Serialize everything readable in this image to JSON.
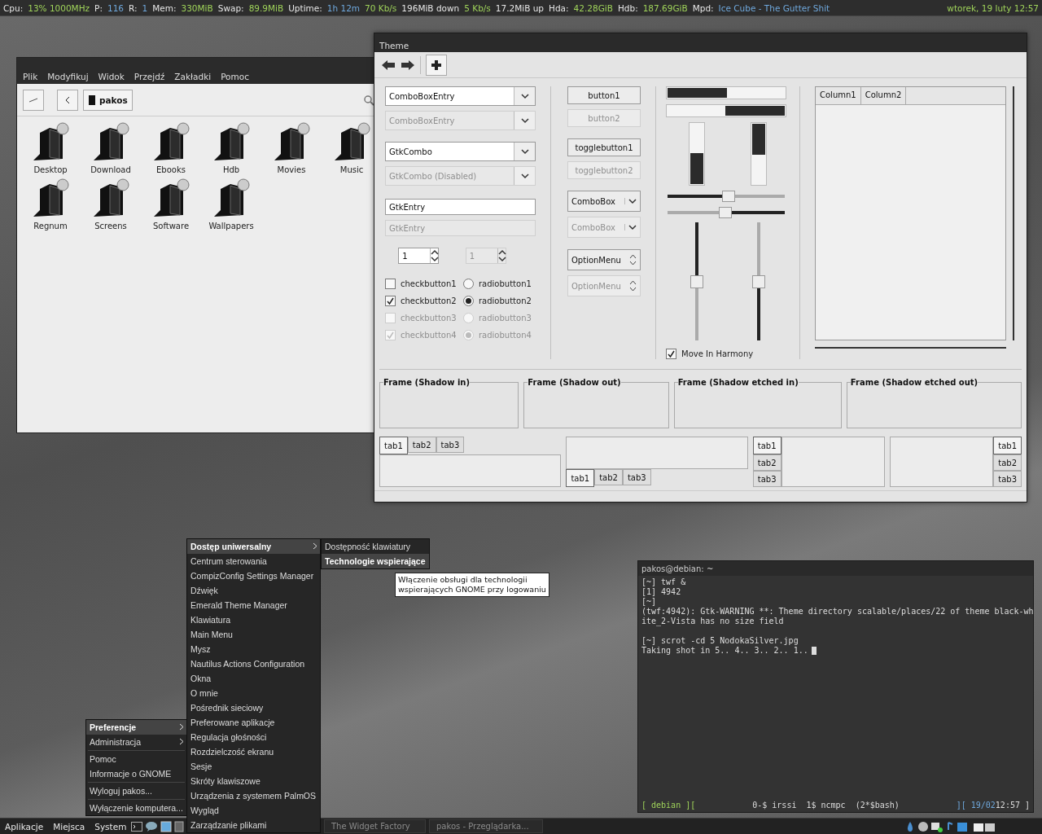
{
  "top_bar": {
    "items": [
      {
        "text": "Cpu:",
        "kind": "label"
      },
      {
        "text": "13% 1000MHz",
        "kind": "value"
      },
      {
        "text": "P:",
        "kind": "label"
      },
      {
        "text": "116",
        "kind": "accent"
      },
      {
        "text": "R:",
        "kind": "label"
      },
      {
        "text": "1",
        "kind": "accent"
      },
      {
        "text": "Mem:",
        "kind": "label"
      },
      {
        "text": "330MiB",
        "kind": "value"
      },
      {
        "text": "Swap:",
        "kind": "label"
      },
      {
        "text": "89.9MiB",
        "kind": "value"
      },
      {
        "text": "Uptime:",
        "kind": "label"
      },
      {
        "text": "1h 12m",
        "kind": "accent"
      },
      {
        "text": "70 Kb/s",
        "kind": "value"
      },
      {
        "text": "196MiB down",
        "kind": "label"
      },
      {
        "text": "5 Kb/s",
        "kind": "value"
      },
      {
        "text": "17.2MiB up",
        "kind": "label"
      },
      {
        "text": "Hda:",
        "kind": "label"
      },
      {
        "text": "42.28GiB",
        "kind": "value"
      },
      {
        "text": "Hdb:",
        "kind": "label"
      },
      {
        "text": "187.69GiB",
        "kind": "value"
      },
      {
        "text": "Mpd:",
        "kind": "label"
      },
      {
        "text": "Ice Cube - The Gutter Shit",
        "kind": "accent"
      }
    ],
    "clock": "wtorek, 19 luty 12:57"
  },
  "file_manager": {
    "menu": [
      "Plik",
      "Modyfikuj",
      "Widok",
      "Przejdź",
      "Zakładki",
      "Pomoc"
    ],
    "location": "pakos",
    "files": [
      {
        "name": "Desktop"
      },
      {
        "name": "Download"
      },
      {
        "name": "Ebooks"
      },
      {
        "name": "Hdb"
      },
      {
        "name": "Movies"
      },
      {
        "name": "Music"
      },
      {
        "name": "Regnum"
      },
      {
        "name": "Screens"
      },
      {
        "name": "Software"
      },
      {
        "name": "Wallpapers"
      }
    ]
  },
  "theme_window": {
    "title": "Theme",
    "combos": [
      {
        "text": "ComboBoxEntry",
        "disabled": false
      },
      {
        "text": "ComboBoxEntry",
        "disabled": true
      },
      {
        "text": "GtkCombo",
        "disabled": false
      },
      {
        "text": "GtkCombo (Disabled)",
        "disabled": true
      }
    ],
    "entries": [
      {
        "value": "GtkEntry",
        "disabled": false
      },
      {
        "value": "GtkEntry",
        "disabled": true
      }
    ],
    "spins": [
      {
        "value": "1",
        "disabled": false
      },
      {
        "value": "1",
        "disabled": true
      }
    ],
    "checks": [
      {
        "label": "checkbutton1",
        "checked": false,
        "disabled": false
      },
      {
        "label": "checkbutton2",
        "checked": true,
        "disabled": false
      },
      {
        "label": "checkbutton3",
        "checked": false,
        "disabled": true
      },
      {
        "label": "checkbutton4",
        "checked": true,
        "disabled": true
      }
    ],
    "radios": [
      {
        "label": "radiobutton1",
        "selected": false,
        "disabled": false
      },
      {
        "label": "radiobutton2",
        "selected": true,
        "disabled": false
      },
      {
        "label": "radiobutton3",
        "selected": false,
        "disabled": true
      },
      {
        "label": "radiobutton4",
        "selected": true,
        "disabled": true
      }
    ],
    "buttons": [
      {
        "label": "button1",
        "kind": "button",
        "disabled": false
      },
      {
        "label": "button2",
        "kind": "button",
        "disabled": true
      },
      {
        "label": "togglebutton1",
        "kind": "button",
        "disabled": false
      },
      {
        "label": "togglebutton2",
        "kind": "button",
        "disabled": true
      },
      {
        "label": "ComboBox",
        "kind": "combo",
        "disabled": false
      },
      {
        "label": "ComboBox",
        "kind": "combo",
        "disabled": true
      },
      {
        "label": "OptionMenu",
        "kind": "option",
        "disabled": false
      },
      {
        "label": "OptionMenu",
        "kind": "option",
        "disabled": true
      }
    ],
    "progress": {
      "horizontal": [
        {
          "inverted": false,
          "level": 0.5
        },
        {
          "inverted": true,
          "level": 0.5
        }
      ],
      "vertical": [
        {
          "inverted": false,
          "level": 0.5
        },
        {
          "inverted": true,
          "level": 0.5
        }
      ]
    },
    "scales": {
      "horizontal": [
        {
          "inverted": false,
          "level": 0.52
        },
        {
          "inverted": true,
          "level": 0.49
        }
      ],
      "vertical": [
        {
          "inverted": true,
          "level": 0.5
        },
        {
          "inverted": false,
          "level": 0.5
        }
      ]
    },
    "harmony": {
      "label": "Move In Harmony",
      "checked": true
    },
    "tree": {
      "columns": [
        "Column1",
        "Column2"
      ]
    },
    "frames": [
      "Frame (Shadow in)",
      "Frame (Shadow out)",
      "Frame (Shadow etched in)",
      "Frame (Shadow etched out)"
    ],
    "notebooks": {
      "top": {
        "tabs": [
          {
            "label": "tab1",
            "selected": true
          },
          {
            "label": "tab2",
            "selected": false
          },
          {
            "label": "tab3",
            "selected": false
          }
        ]
      },
      "bottom": {
        "tabs": [
          {
            "label": "tab1",
            "selected": true
          },
          {
            "label": "tab2",
            "selected": false
          },
          {
            "label": "tab3",
            "selected": false
          }
        ]
      },
      "left": {
        "tabs": [
          {
            "label": "tab1",
            "selected": true
          },
          {
            "label": "tab2",
            "selected": false
          },
          {
            "label": "tab3",
            "selected": false
          }
        ]
      },
      "right": {
        "tabs": [
          {
            "label": "tab1",
            "selected": true
          },
          {
            "label": "tab2",
            "selected": false
          },
          {
            "label": "tab3",
            "selected": false
          }
        ]
      }
    }
  },
  "system_menu": {
    "groups": [
      {
        "items": [
          {
            "label": "Preferencje",
            "selected": true,
            "submenu": true
          },
          {
            "label": "Administracja",
            "selected": false,
            "submenu": true
          }
        ]
      },
      {
        "items": [
          {
            "label": "Pomoc",
            "selected": false,
            "submenu": false
          },
          {
            "label": "Informacje o GNOME",
            "selected": false,
            "submenu": false
          }
        ]
      },
      {
        "items": [
          {
            "label": "Wyloguj pakos...",
            "selected": false,
            "submenu": false
          }
        ]
      },
      {
        "items": [
          {
            "label": "Wyłączenie komputera...",
            "selected": false,
            "submenu": false
          }
        ]
      }
    ]
  },
  "preferences_menu": {
    "items": [
      {
        "label": "Dostęp uniwersalny",
        "selected": true,
        "submenu": true
      },
      {
        "label": "Centrum sterowania",
        "selected": false,
        "submenu": false
      },
      {
        "label": "CompizConfig Settings Manager",
        "selected": false,
        "submenu": false
      },
      {
        "label": "Dźwięk",
        "selected": false,
        "submenu": false
      },
      {
        "label": "Emerald Theme Manager",
        "selected": false,
        "submenu": false
      },
      {
        "label": "Klawiatura",
        "selected": false,
        "submenu": false
      },
      {
        "label": "Main Menu",
        "selected": false,
        "submenu": false
      },
      {
        "label": "Mysz",
        "selected": false,
        "submenu": false
      },
      {
        "label": "Nautilus Actions Configuration",
        "selected": false,
        "submenu": false
      },
      {
        "label": "Okna",
        "selected": false,
        "submenu": false
      },
      {
        "label": "O mnie",
        "selected": false,
        "submenu": false
      },
      {
        "label": "Pośrednik sieciowy",
        "selected": false,
        "submenu": false
      },
      {
        "label": "Preferowane aplikacje",
        "selected": false,
        "submenu": false
      },
      {
        "label": "Regulacja głośności",
        "selected": false,
        "submenu": false
      },
      {
        "label": "Rozdzielczość ekranu",
        "selected": false,
        "submenu": false
      },
      {
        "label": "Sesje",
        "selected": false,
        "submenu": false
      },
      {
        "label": "Skróty klawiszowe",
        "selected": false,
        "submenu": false
      },
      {
        "label": "Urządzenia z systemem PalmOS",
        "selected": false,
        "submenu": false
      },
      {
        "label": "Wygląd",
        "selected": false,
        "submenu": false
      },
      {
        "label": "Zarządzanie plikami",
        "selected": false,
        "submenu": false
      }
    ]
  },
  "accessibility_menu": {
    "items": [
      {
        "label": "Dostępność klawiatury",
        "selected": false
      },
      {
        "label": "Technologie wspierające",
        "selected": true
      }
    ]
  },
  "tooltip": "Włączenie obsługi dla technologii wspierających GNOME przy logowaniu",
  "terminal": {
    "title": "pakos@debian: ~",
    "blocks": [
      [
        "[~] twf &",
        "[1] 4942",
        "[~]",
        "(twf:4942): Gtk-WARNING **: Theme directory scalable/places/22 of theme black-wh",
        "ite_2-Vista has no size field"
      ],
      [
        "[~] scrot -cd 5 NodokaSilver.jpg",
        "Taking shot in 5.. 4.. 3.. 2.. 1.."
      ]
    ],
    "status": {
      "host": "[ debian ][",
      "windows": "0-$ irssi  1$ ncmpc  (2*$bash)",
      "date": "][ 19/02",
      "time": "12:57 ]"
    }
  },
  "bottom_panel": {
    "menus": [
      "Aplikacje",
      "Miejsca",
      "System"
    ],
    "tasks": [
      {
        "label": "The Widget Factory",
        "selected": false
      },
      {
        "label": "pakos - Przeglądarka...",
        "selected": false
      }
    ]
  }
}
